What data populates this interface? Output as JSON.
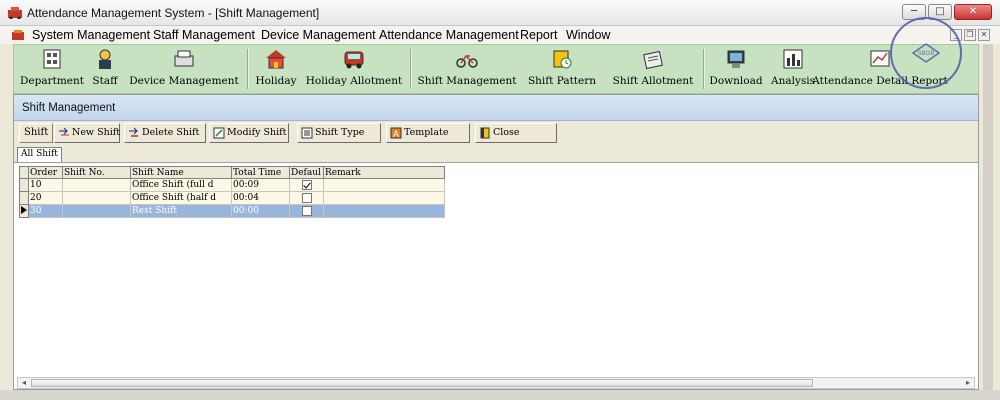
{
  "window": {
    "title": "Attendance Management System - [Shift Management]",
    "controls": {
      "minimize": "─",
      "maximize": "□",
      "close": "✕"
    }
  },
  "menu": {
    "items": [
      "System Management",
      "Staff Management",
      "Device Management",
      "Attendance Management",
      "Report",
      "Window"
    ],
    "mdi_controls": {
      "minimize": "_",
      "restore": "❐",
      "close": "✕"
    }
  },
  "toolbar": {
    "buttons": [
      {
        "label": "Department",
        "icon": "department-icon"
      },
      {
        "label": "Staff",
        "icon": "staff-icon"
      },
      {
        "label": "Device Management",
        "icon": "device-icon"
      },
      {
        "label": "Holiday",
        "icon": "holiday-icon"
      },
      {
        "label": "Holiday Allotment",
        "icon": "holiday-allotment-icon"
      },
      {
        "label": "Shift Management",
        "icon": "shift-management-icon"
      },
      {
        "label": "Shift Pattern",
        "icon": "shift-pattern-icon"
      },
      {
        "label": "Shift Allotment",
        "icon": "shift-allotment-icon"
      },
      {
        "label": "Download",
        "icon": "download-icon"
      },
      {
        "label": "Analysis",
        "icon": "analysis-icon"
      },
      {
        "label": "Attendance Detail Report",
        "icon": "attendance-report-icon"
      }
    ]
  },
  "stamp": {
    "text": "SHAN SUS ELECTRIC CO.,LTD",
    "logo_text": "SBGB"
  },
  "panel": {
    "title": "Shift Management",
    "tab_label": "Shift",
    "actions": [
      {
        "label": "New Shift",
        "icon": "new-shift-icon"
      },
      {
        "label": "Delete Shift",
        "icon": "delete-shift-icon"
      },
      {
        "label": "Modify Shift",
        "icon": "modify-shift-icon"
      },
      {
        "label": "Shift Type",
        "icon": "shift-type-icon"
      },
      {
        "label": "Template",
        "icon": "template-icon"
      },
      {
        "label": "Close",
        "icon": "close-door-icon"
      }
    ],
    "filter_tab": "All Shift"
  },
  "grid": {
    "columns": [
      "Order",
      "Shift No.",
      "Shift Name",
      "Total Time",
      "Defaul",
      "Remark"
    ],
    "rows": [
      {
        "order": "10",
        "shift_no": "",
        "shift_name": "Office Shift (full d",
        "total_time": "00:09",
        "default": true,
        "remark": ""
      },
      {
        "order": "20",
        "shift_no": "",
        "shift_name": "Office Shift (half d",
        "total_time": "00:04",
        "default": false,
        "remark": ""
      },
      {
        "order": "30",
        "shift_no": "",
        "shift_name": "Rest Shift",
        "total_time": "00:00",
        "default": false,
        "remark": "",
        "selected": true
      }
    ]
  },
  "scrollbar": {
    "left_arrow": "◂",
    "right_arrow": "▸"
  },
  "colors": {
    "toolbar_bg": "#c6e2c0",
    "selected_row": "#98b5dc",
    "row_bg": "#fbf8e6",
    "header_bg": "#c4d6ee"
  }
}
